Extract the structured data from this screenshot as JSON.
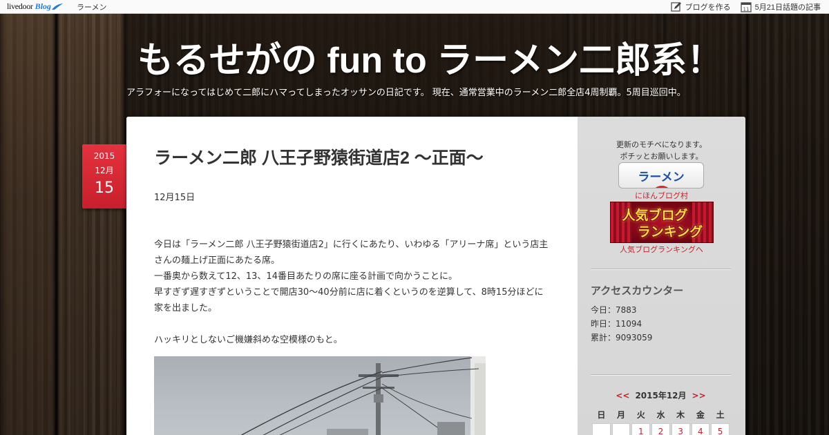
{
  "topbar": {
    "logo_text": "livedoor",
    "logo_blog": "Blog",
    "nav_item": "ラーメン",
    "create_blog": "ブログを作る",
    "topic_label": "5月21日話題の記事",
    "calendar_icon_day": "11"
  },
  "header": {
    "title": "もるせがの fun to ラーメン二郎系！",
    "description": "アラフォーになってはじめて二郎にハマってしまったオッサンの日記です。 現在、通常営業中のラーメン二郎全店4周制覇。5周目巡回中。"
  },
  "post": {
    "date_year": "2015",
    "date_month": "12月",
    "date_day": "15",
    "title": "ラーメン二郎 八王子野猿街道店2 〜正面〜",
    "date_line": "12月15日",
    "body": {
      "p1": "今日は「ラーメン二郎 八王子野猿街道店2」に行くにあたり、いわゆる「アリーナ席」という店主さんの麺上げ正面にあたる席。",
      "p2": "一番奥から数えて12、13、14番目あたりの席に座る計画で向かうことに。",
      "p3": "早すぎず遅すぎずということで開店30～40分前に店に着くというのを逆算して、8時15分ほどに家を出ました。",
      "p4": "ハッキリとしないご機嫌斜めな空模様のもと。"
    }
  },
  "sidebar": {
    "motive_line1": "更新のモチベになります。",
    "motive_line2": "ポチッとお願いします。",
    "ramen_button": "ラーメン",
    "nihon_link": "にほんブログ村",
    "rank_banner_line1": "人気ブログ",
    "rank_banner_line2": "ランキング",
    "rank_link": "人気ブログランキングへ",
    "counter_heading": "アクセスカウンター",
    "counter_today": "今日：7883",
    "counter_yesterday": "昨日：11094",
    "counter_total": "累計：9093059",
    "calendar": {
      "prev": "<<",
      "month": "2015年12月",
      "next": ">>",
      "weekdays": [
        "日",
        "月",
        "火",
        "水",
        "木",
        "金",
        "土"
      ],
      "first_row": [
        "",
        "",
        "1",
        "2",
        "3",
        "4",
        "5"
      ]
    }
  },
  "colors": {
    "accent_red": "#c0222c",
    "badge_red": "#d8262f",
    "sidebar_bg": "#d9d9d9"
  }
}
